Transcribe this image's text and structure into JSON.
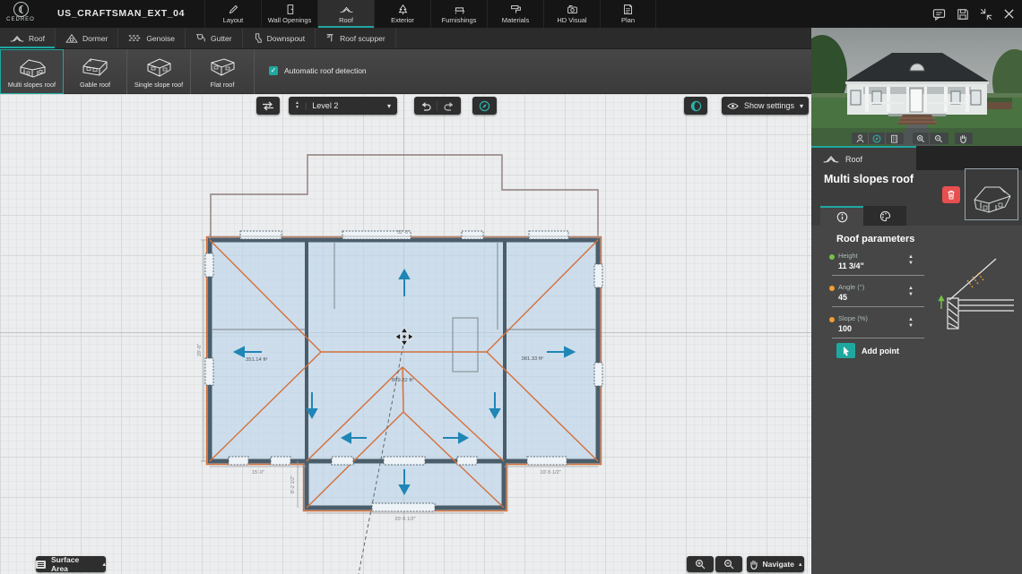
{
  "window": {
    "logo": "CEDREO",
    "project_title": "US_CRAFTSMAN_EXT_04"
  },
  "top_tabs": [
    {
      "label": "Layout"
    },
    {
      "label": "Wall Openings"
    },
    {
      "label": "Roof",
      "active": true
    },
    {
      "label": "Exterior"
    },
    {
      "label": "Furnishings"
    },
    {
      "label": "Materials"
    },
    {
      "label": "HD Visual"
    },
    {
      "label": "Plan"
    }
  ],
  "tool_tabs": [
    {
      "label": "Roof",
      "active": true
    },
    {
      "label": "Dormer"
    },
    {
      "label": "Genoise"
    },
    {
      "label": "Gutter"
    },
    {
      "label": "Downspout"
    },
    {
      "label": "Roof scupper"
    }
  ],
  "roof_types": [
    {
      "label": "Multi slopes roof",
      "active": true
    },
    {
      "label": "Gable roof"
    },
    {
      "label": "Single slope roof"
    },
    {
      "label": "Flat roof"
    }
  ],
  "auto_detect_label": "Automatic roof detection",
  "canvas_controls": {
    "level": "Level 2",
    "show_settings": "Show settings",
    "surface_area": "Surface Area",
    "navigate": "Navigate"
  },
  "plan": {
    "left_area": "351.14 ft²",
    "center_area": "889.32 ft²",
    "right_area": "381.33 ft²",
    "dim_top": "52'-0\"",
    "dim_left": "29'-8\"",
    "dim_bottom_left": "15'-0\"",
    "dim_bottom_right": "10'-5 1/2\"",
    "dim_ext_width": "20'-5 1/2\"",
    "dim_ext_height": "8'-2 1/2\""
  },
  "panel": {
    "tab": "Roof",
    "title": "Multi slopes roof",
    "params_title": "Roof parameters",
    "height_label": "Height",
    "height_value": "11 3/4\"",
    "angle_label": "Angle (°)",
    "angle_value": "45",
    "slope_label": "Slope (%)",
    "slope_value": "100",
    "add_point_label": "Add point"
  },
  "colors": {
    "accent": "#1fa8a0",
    "delete": "#e84f4f",
    "roof_line": "#d4703c",
    "arrow": "#1f86b5",
    "height_dot": "#76c043",
    "angle_dot": "#f09f33"
  }
}
